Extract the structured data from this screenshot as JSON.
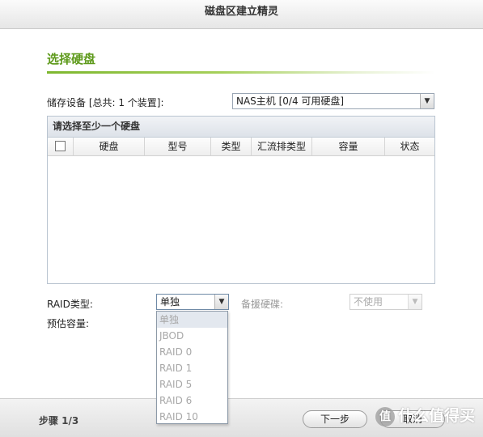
{
  "window": {
    "title": "磁盘区建立精灵"
  },
  "section": {
    "title": "选择硬盘"
  },
  "storage": {
    "label": "储存设备 [总共: 1 个装置]:",
    "selected": "NAS主机 [0/4 可用硬盘]"
  },
  "disk_panel": {
    "title": "请选择至少一个硬盘",
    "columns": [
      "硬盘",
      "型号",
      "类型",
      "汇流排类型",
      "容量",
      "状态"
    ]
  },
  "raid": {
    "label": "RAID类型:",
    "selected": "单独",
    "options": [
      "单独",
      "JBOD",
      "RAID 0",
      "RAID 1",
      "RAID 5",
      "RAID 6",
      "RAID 10"
    ]
  },
  "spare": {
    "label": "备援硬碟:",
    "selected": "不使用"
  },
  "capacity": {
    "label": "预估容量:"
  },
  "footer": {
    "step": "步骤 1/3",
    "next_label": "下一步",
    "cancel_label": "取消"
  },
  "watermark": {
    "text": "什么值得买",
    "icon": "值"
  },
  "icons": {
    "dropdown": "chevron-down-icon"
  },
  "colors": {
    "accent": "#5e9a1b",
    "panel_border": "#b9c4d0"
  }
}
